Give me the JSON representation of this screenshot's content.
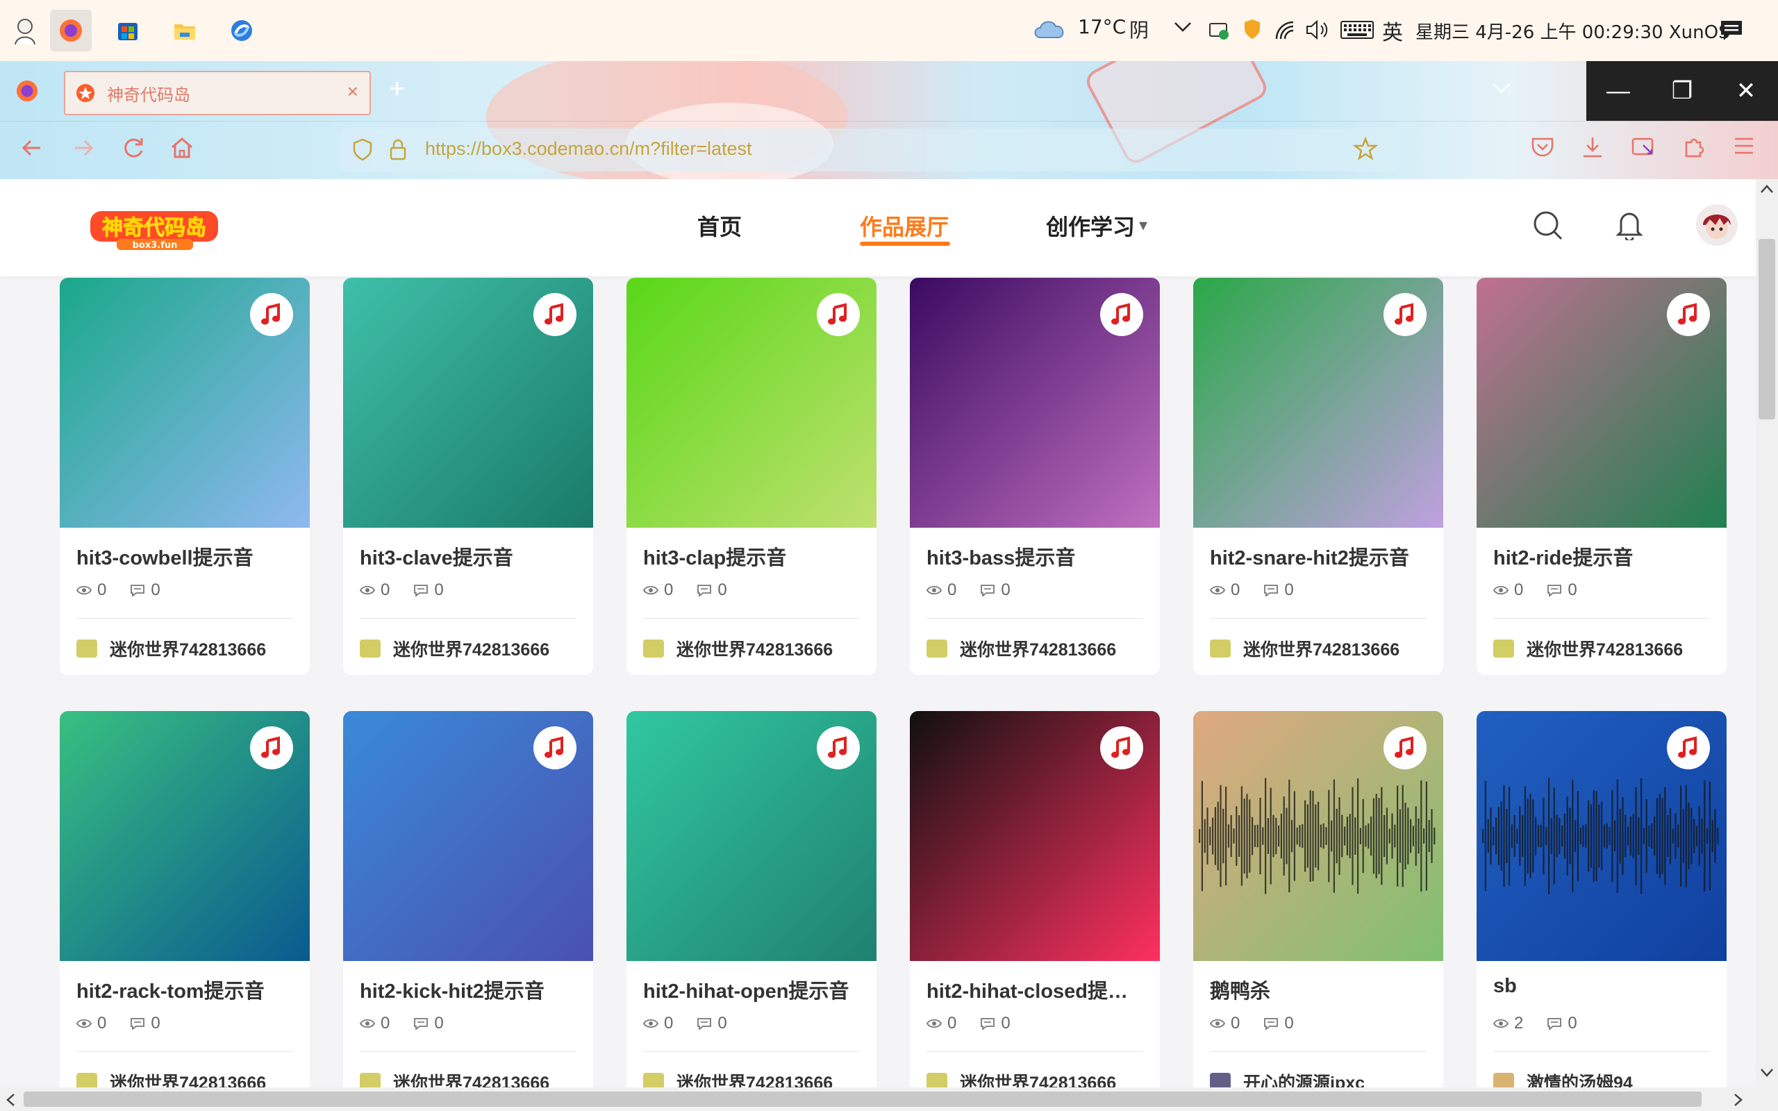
{
  "taskbar": {
    "weather": "17°C",
    "condition": "阴",
    "ime": "英",
    "datetime": "星期三 4月-26 上午 00:29:30 XunOS"
  },
  "browser": {
    "tab_title": "神奇代码岛",
    "tab_close": "×",
    "new_tab": "+",
    "url": "https://box3.codemao.cn/m?filter=latest",
    "win_min": "—",
    "win_restore": "❐",
    "win_close": "✕"
  },
  "site": {
    "logo_text": "神奇代码岛",
    "logo_sub": "box3.fun",
    "nav": [
      {
        "label": "首页"
      },
      {
        "label": "作品展厅"
      },
      {
        "label": "创作学习"
      }
    ],
    "nav_dropdown_caret": "▾"
  },
  "cards": [
    {
      "title": "hit3-cowbell提示音",
      "views": "0",
      "comments": "0",
      "author": "迷你世界742813666",
      "grad": [
        "#1aa88a",
        "#8fb8f0"
      ]
    },
    {
      "title": "hit3-clave提示音",
      "views": "0",
      "comments": "0",
      "author": "迷你世界742813666",
      "grad": [
        "#3fc0a8",
        "#1a7a6a"
      ]
    },
    {
      "title": "hit3-clap提示音",
      "views": "0",
      "comments": "0",
      "author": "迷你世界742813666",
      "grad": [
        "#58d818",
        "#c0e070"
      ]
    },
    {
      "title": "hit3-bass提示音",
      "views": "0",
      "comments": "0",
      "author": "迷你世界742813666",
      "grad": [
        "#3a0a60",
        "#c070c0"
      ]
    },
    {
      "title": "hit2-snare-hit2提示音",
      "views": "0",
      "comments": "0",
      "author": "迷你世界742813666",
      "grad": [
        "#2aa848",
        "#c0a0e0"
      ]
    },
    {
      "title": "hit2-ride提示音",
      "views": "0",
      "comments": "0",
      "author": "迷你世界742813666",
      "grad": [
        "#c07090",
        "#208050"
      ]
    },
    {
      "title": "hit2-rack-tom提示音",
      "views": "0",
      "comments": "0",
      "author": "迷你世界742813666",
      "grad": [
        "#38c080",
        "#0a5a90"
      ]
    },
    {
      "title": "hit2-kick-hit2提示音",
      "views": "0",
      "comments": "0",
      "author": "迷你世界742813666",
      "grad": [
        "#3a8ad8",
        "#4a50b0"
      ]
    },
    {
      "title": "hit2-hihat-open提示音",
      "views": "0",
      "comments": "0",
      "author": "迷你世界742813666",
      "grad": [
        "#30c8a0",
        "#208070"
      ]
    },
    {
      "title": "hit2-hihat-closed提…",
      "views": "0",
      "comments": "0",
      "author": "迷你世界742813666",
      "grad": [
        "#101010",
        "#ff3060"
      ]
    },
    {
      "title": "鹅鸭杀",
      "views": "0",
      "comments": "0",
      "author": "开心的源源jpxc",
      "grad": [
        "#e0a880",
        "#80c070"
      ]
    },
    {
      "title": "sb",
      "views": "2",
      "comments": "0",
      "author": "激情的汤姆94",
      "grad": [
        "#2060c0",
        "#1040a0"
      ]
    }
  ],
  "colors": {
    "accent": "#ff7a1a",
    "music_icon": "#e02020",
    "chrome_icon": "#e8736a"
  }
}
